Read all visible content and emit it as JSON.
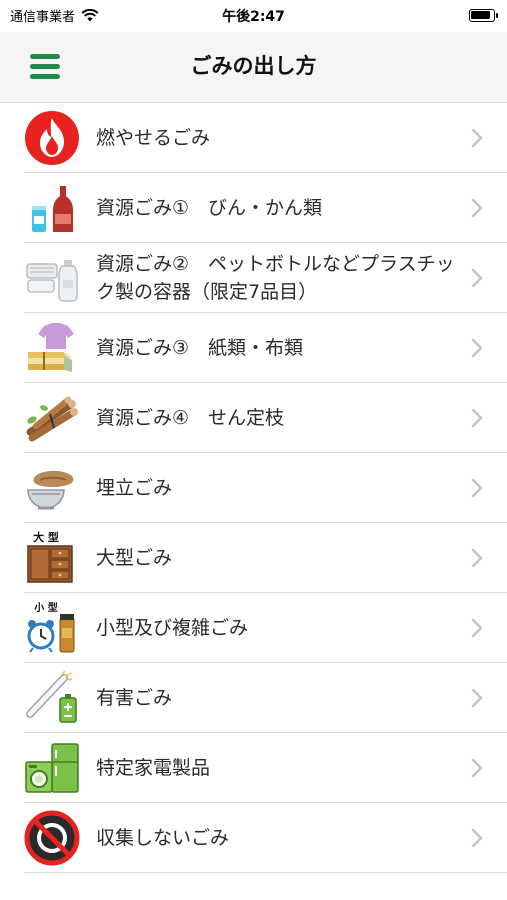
{
  "status_bar": {
    "carrier": "通信事業者",
    "time": "午後2:47"
  },
  "header": {
    "title": "ごみの出し方"
  },
  "categories": [
    {
      "label": "燃やせるごみ",
      "icon": "flame-icon"
    },
    {
      "label": "資源ごみ①　びん・かん類",
      "icon": "bottle-can-icon"
    },
    {
      "label": "資源ごみ②　ペットボトルなどプラスチック製の容器（限定7品目）",
      "icon": "plastic-container-icon"
    },
    {
      "label": "資源ごみ③　紙類・布類",
      "icon": "paper-cloth-icon"
    },
    {
      "label": "資源ごみ④　せん定枝",
      "icon": "branches-icon"
    },
    {
      "label": "埋立ごみ",
      "icon": "pottery-icon"
    },
    {
      "label": "大型ごみ",
      "icon": "furniture-icon",
      "badge": "大 型"
    },
    {
      "label": "小型及び複雑ごみ",
      "icon": "small-appliance-icon",
      "badge": "小 型"
    },
    {
      "label": "有害ごみ",
      "icon": "hazardous-icon"
    },
    {
      "label": "特定家電製品",
      "icon": "home-appliance-icon"
    },
    {
      "label": "収集しないごみ",
      "icon": "no-collection-icon"
    }
  ],
  "colors": {
    "accent": "#1f8a4c",
    "separator": "#dedede",
    "chevron": "#c4c4c4"
  }
}
